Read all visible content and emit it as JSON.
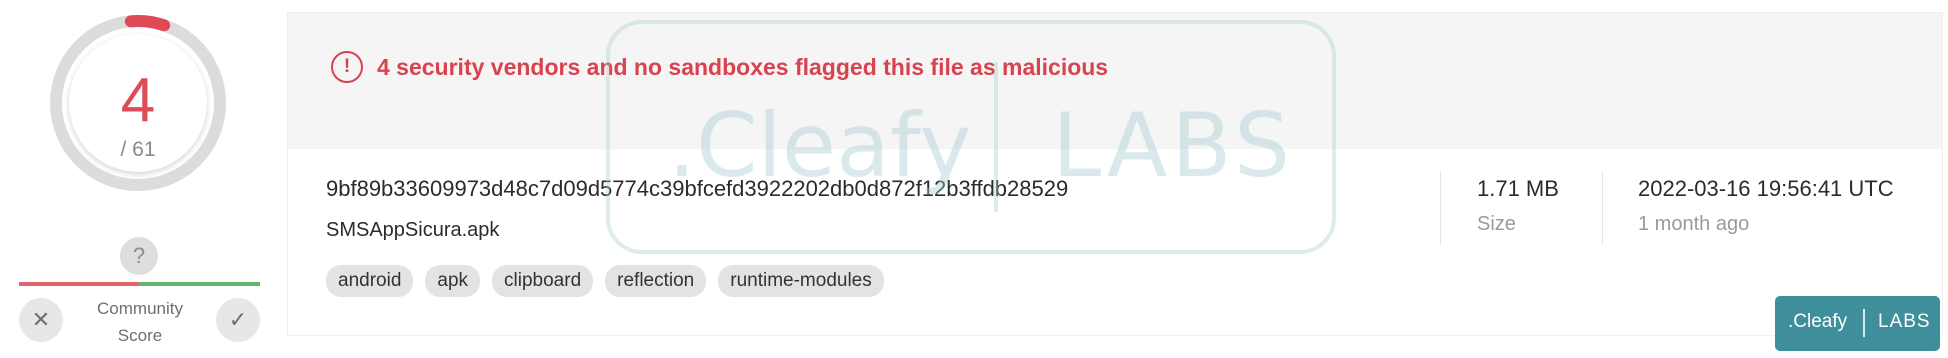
{
  "score": {
    "detected": "4",
    "total": "/ 61",
    "detected_fraction": 0.0656,
    "ring_color": "#de4b57"
  },
  "community": {
    "help_symbol": "?",
    "label_line1": "Community",
    "label_line2": "Score",
    "downvote_icon": "close-icon",
    "upvote_icon": "check-icon",
    "bad_color": "#e0636d",
    "good_color": "#61b66b"
  },
  "alert": {
    "icon": "!",
    "text": "4 security vendors and no sandboxes flagged this file as malicious",
    "color": "#d9424f"
  },
  "file": {
    "hash": "9bf89b33609973d48c7d09d5774c39bfcefd3922202db0d872f12b3ffdb28529",
    "name": "SMSAppSicura.apk",
    "tags": [
      "android",
      "apk",
      "clipboard",
      "reflection",
      "runtime-modules"
    ]
  },
  "size": {
    "value": "1.71 MB",
    "label": "Size"
  },
  "date": {
    "value": "2022-03-16 19:56:41 UTC",
    "relative": "1 month ago"
  },
  "watermark": {
    "brand": ".Cleafy",
    "labs": "LABS"
  },
  "badge": {
    "brand": ".Cleafy",
    "labs": "LABS",
    "color": "#3f8e9c"
  }
}
